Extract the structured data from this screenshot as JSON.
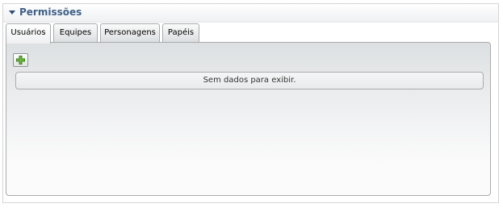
{
  "panel": {
    "title": "Permissões"
  },
  "tabs": [
    {
      "label": "Usuários",
      "active": true
    },
    {
      "label": "Equipes",
      "active": false
    },
    {
      "label": "Personagens",
      "active": false
    },
    {
      "label": "Papéis",
      "active": false
    }
  ],
  "toolbar": {
    "add_icon": "plus-icon",
    "add_color": "#5aa02c"
  },
  "grid": {
    "empty_text": "Sem dados para exibir."
  }
}
